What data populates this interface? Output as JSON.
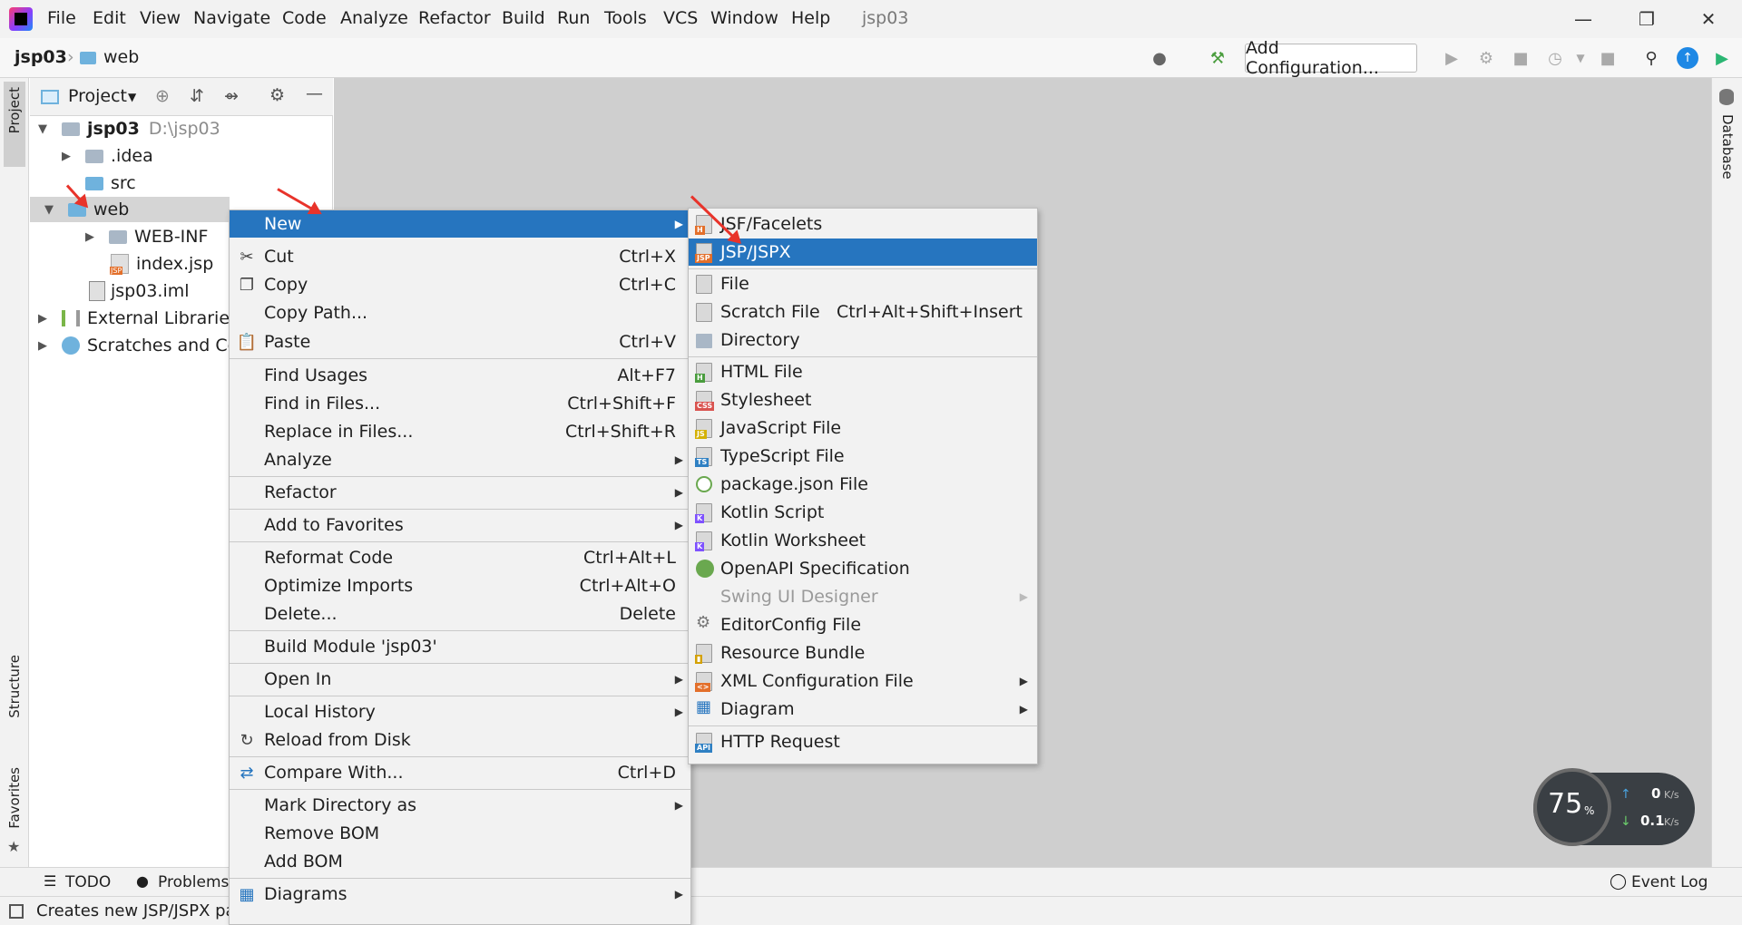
{
  "titlebar": {
    "menus": [
      "File",
      "Edit",
      "View",
      "Navigate",
      "Code",
      "Analyze",
      "Refactor",
      "Build",
      "Run",
      "Tools",
      "VCS",
      "Window",
      "Help"
    ],
    "project_title": "jsp03"
  },
  "navbar": {
    "crumb_project": "jsp03",
    "crumb_folder": "web",
    "add_config": "Add Configuration..."
  },
  "side_tabs": {
    "project": "Project",
    "structure": "Structure",
    "favorites": "Favorites",
    "database": "Database"
  },
  "project_panel": {
    "title": "Project",
    "tree": [
      {
        "label": "jsp03",
        "extra": "D:\\jsp03"
      },
      {
        "label": ".idea"
      },
      {
        "label": "src"
      },
      {
        "label": "web"
      },
      {
        "label": "WEB-INF"
      },
      {
        "label": "index.jsp"
      },
      {
        "label": "jsp03.iml"
      },
      {
        "label": "External Libraries"
      },
      {
        "label": "Scratches and Cor"
      }
    ]
  },
  "context_menu": {
    "items": [
      {
        "label": "New",
        "shortcut": ""
      },
      {
        "label": "Cut",
        "shortcut": "Ctrl+X"
      },
      {
        "label": "Copy",
        "shortcut": "Ctrl+C"
      },
      {
        "label": "Copy Path...",
        "shortcut": ""
      },
      {
        "label": "Paste",
        "shortcut": "Ctrl+V"
      },
      {
        "label": "Find Usages",
        "shortcut": "Alt+F7"
      },
      {
        "label": "Find in Files...",
        "shortcut": "Ctrl+Shift+F"
      },
      {
        "label": "Replace in Files...",
        "shortcut": "Ctrl+Shift+R"
      },
      {
        "label": "Analyze",
        "shortcut": ""
      },
      {
        "label": "Refactor",
        "shortcut": ""
      },
      {
        "label": "Add to Favorites",
        "shortcut": ""
      },
      {
        "label": "Reformat Code",
        "shortcut": "Ctrl+Alt+L"
      },
      {
        "label": "Optimize Imports",
        "shortcut": "Ctrl+Alt+O"
      },
      {
        "label": "Delete...",
        "shortcut": "Delete"
      },
      {
        "label": "Build Module 'jsp03'",
        "shortcut": ""
      },
      {
        "label": "Open In",
        "shortcut": ""
      },
      {
        "label": "Local History",
        "shortcut": ""
      },
      {
        "label": "Reload from Disk",
        "shortcut": ""
      },
      {
        "label": "Compare With...",
        "shortcut": "Ctrl+D"
      },
      {
        "label": "Mark Directory as",
        "shortcut": ""
      },
      {
        "label": "Remove BOM",
        "shortcut": ""
      },
      {
        "label": "Add BOM",
        "shortcut": ""
      },
      {
        "label": "Diagrams",
        "shortcut": ""
      }
    ]
  },
  "new_submenu": {
    "items": [
      {
        "label": "JSF/Facelets",
        "shortcut": ""
      },
      {
        "label": "JSP/JSPX",
        "shortcut": ""
      },
      {
        "label": "File",
        "shortcut": ""
      },
      {
        "label": "Scratch File",
        "shortcut": "Ctrl+Alt+Shift+Insert"
      },
      {
        "label": "Directory",
        "shortcut": ""
      },
      {
        "label": "HTML File",
        "shortcut": ""
      },
      {
        "label": "Stylesheet",
        "shortcut": ""
      },
      {
        "label": "JavaScript File",
        "shortcut": ""
      },
      {
        "label": "TypeScript File",
        "shortcut": ""
      },
      {
        "label": "package.json File",
        "shortcut": ""
      },
      {
        "label": "Kotlin Script",
        "shortcut": ""
      },
      {
        "label": "Kotlin Worksheet",
        "shortcut": ""
      },
      {
        "label": "OpenAPI Specification",
        "shortcut": ""
      },
      {
        "label": "Swing UI Designer",
        "shortcut": ""
      },
      {
        "label": "EditorConfig File",
        "shortcut": ""
      },
      {
        "label": "Resource Bundle",
        "shortcut": ""
      },
      {
        "label": "XML Configuration File",
        "shortcut": ""
      },
      {
        "label": "Diagram",
        "shortcut": ""
      },
      {
        "label": "HTTP Request",
        "shortcut": ""
      }
    ]
  },
  "bottom_tabs": {
    "todo": "TODO",
    "problems": "Problems",
    "event_log": "Event Log"
  },
  "status": {
    "text": "Creates new JSP/JSPX pa"
  },
  "speed_widget": {
    "percent": "75",
    "percent_unit": "%",
    "up": "0",
    "up_unit": "K/s",
    "down": "0.1",
    "down_unit": "K/s"
  }
}
